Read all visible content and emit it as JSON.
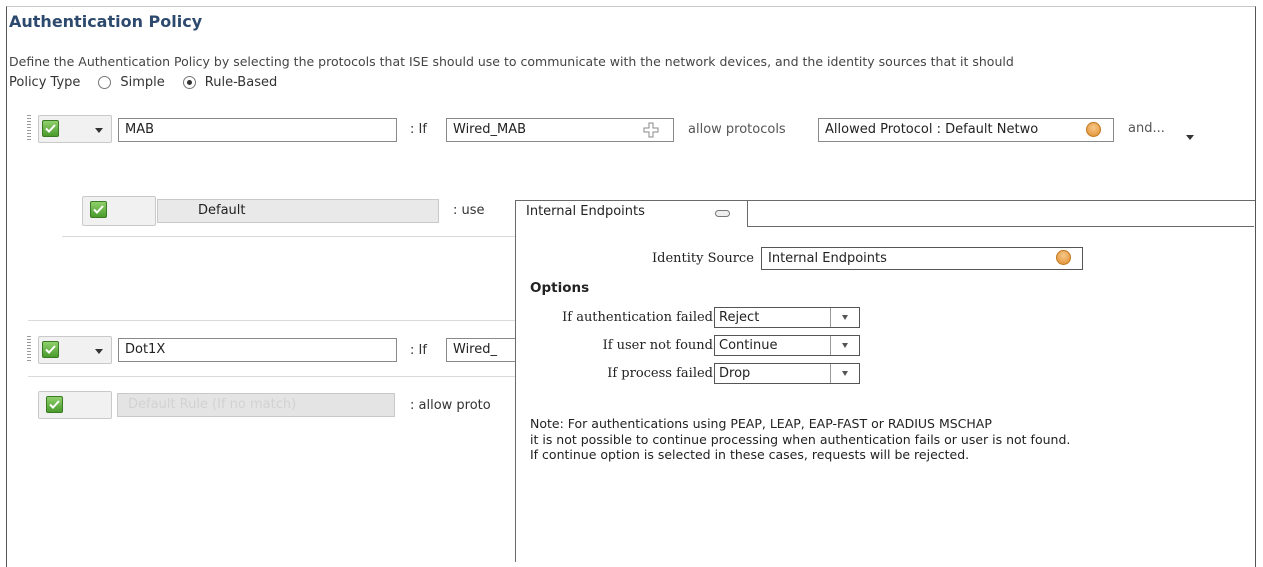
{
  "header": {
    "title": "Authentication Policy",
    "description": "Define the Authentication Policy by selecting the protocols that ISE should use to communicate with the network devices, and the identity sources that it should"
  },
  "policy_type": {
    "label": "Policy Type",
    "options": [
      {
        "label": "Simple",
        "selected": false
      },
      {
        "label": "Rule-Based",
        "selected": true
      }
    ]
  },
  "rules": {
    "mab": {
      "name": "MAB",
      "if_label": ": If",
      "condition": "Wired_MAB",
      "allow_label": "allow protocols",
      "protocol": "Allowed Protocol : Default Netwo",
      "and_label": "and..."
    },
    "mab_default": {
      "name": "Default",
      "use_label": ": use"
    },
    "dot1x": {
      "name": "Dot1X",
      "if_label": ": If",
      "condition": "Wired_"
    },
    "default_rule": {
      "name": "Default Rule (If no match)",
      "allow_label": ":   allow proto"
    }
  },
  "popup": {
    "tab_label": "Internal Endpoints",
    "identity_source_label": "Identity Source",
    "identity_source_value": "Internal Endpoints",
    "options_title": "Options",
    "options": [
      {
        "label": "If authentication failed",
        "value": "Reject"
      },
      {
        "label": "If user not found",
        "value": "Continue"
      },
      {
        "label": "If process failed",
        "value": "Drop"
      }
    ],
    "note_lines": [
      "Note: For authentications using PEAP, LEAP, EAP-FAST or RADIUS MSCHAP",
      "it is not possible to continue processing when authentication fails or user is not found.",
      "If continue option is selected in these cases, requests will be rejected."
    ]
  },
  "colors": {
    "title": "#2d4a6e",
    "checkbox_green": "#5aad36",
    "orange_accent": "#e08e2b"
  }
}
